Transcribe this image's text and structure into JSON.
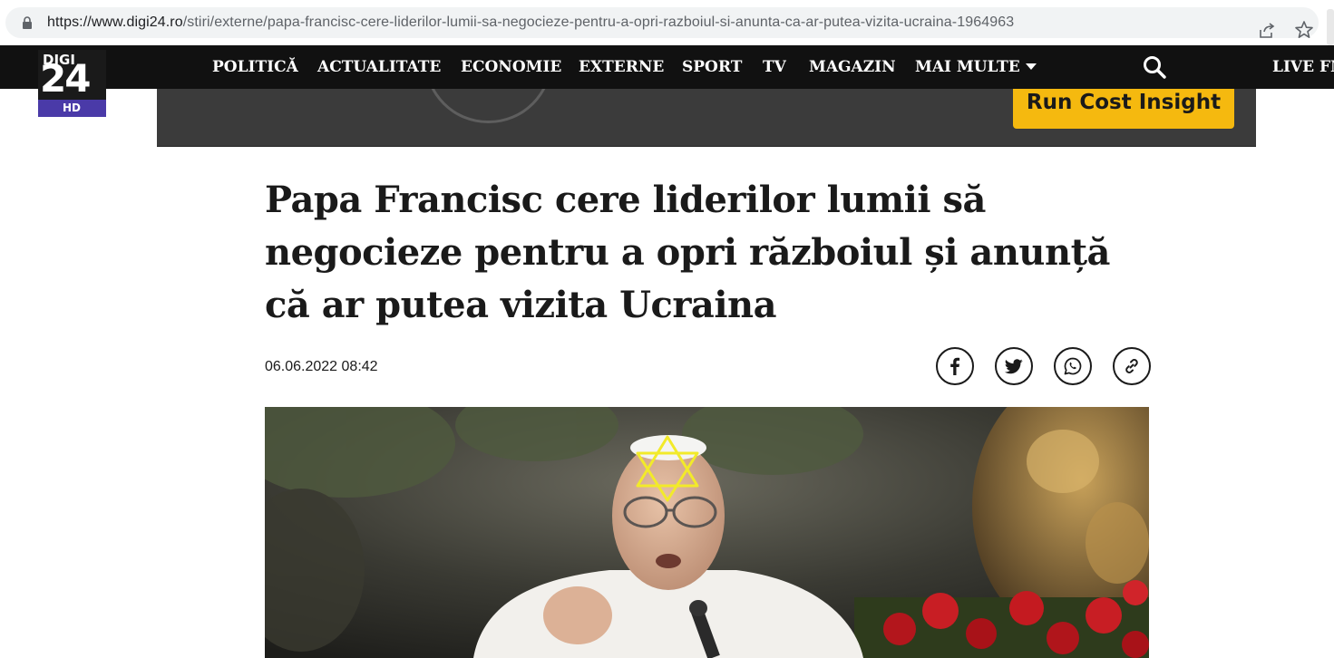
{
  "browser": {
    "url_host": "https://www.digi24.ro",
    "url_path": "/stiri/externe/papa-francisc-cere-liderilor-lumii-sa-negocieze-pentru-a-opri-razboiul-si-anunta-ca-ar-putea-vizita-ucraina-1964963"
  },
  "logo": {
    "top": "DIGI",
    "number": "24",
    "badge": "HD"
  },
  "nav": {
    "items": [
      "POLITICĂ",
      "ACTUALITATE",
      "ECONOMIE",
      "EXTERNE",
      "SPORT",
      "TV",
      "MAGAZIN",
      "MAI MULTE"
    ],
    "live": "LIVE FM"
  },
  "ad": {
    "button_label": "Run Cost Insight"
  },
  "article": {
    "title": "Papa Francisc cere liderilor lumii să negocieze pentru a opri războiul și anunță că ar putea vizita Ucraina",
    "date": "06.06.2022 08:42",
    "share": [
      "facebook-icon",
      "twitter-icon",
      "whatsapp-icon",
      "link-icon"
    ]
  },
  "colors": {
    "nav_bg": "#111111",
    "logo_hd": "#4a3aa8",
    "ad_button": "#f5b90f",
    "overlay_star": "#f2ea2a"
  }
}
